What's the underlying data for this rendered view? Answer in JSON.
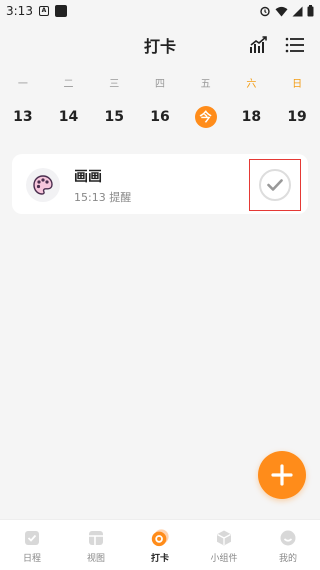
{
  "status_bar": {
    "time": "3:13",
    "notif_letter": "A"
  },
  "header": {
    "title": "打卡"
  },
  "week": {
    "days": [
      {
        "label": "一",
        "date": "13",
        "weekend": false,
        "today": false
      },
      {
        "label": "二",
        "date": "14",
        "weekend": false,
        "today": false
      },
      {
        "label": "三",
        "date": "15",
        "weekend": false,
        "today": false
      },
      {
        "label": "四",
        "date": "16",
        "weekend": false,
        "today": false
      },
      {
        "label": "五",
        "date": "今",
        "weekend": false,
        "today": true
      },
      {
        "label": "六",
        "date": "18",
        "weekend": true,
        "today": false
      },
      {
        "label": "日",
        "date": "19",
        "weekend": true,
        "today": false
      }
    ]
  },
  "task": {
    "title": "画画",
    "reminder": "15:13 提醒"
  },
  "tabs": [
    {
      "label": "日程",
      "icon": "schedule-icon",
      "active": false
    },
    {
      "label": "视图",
      "icon": "view-icon",
      "active": false
    },
    {
      "label": "打卡",
      "icon": "checkin-icon",
      "active": true
    },
    {
      "label": "小组件",
      "icon": "widget-icon",
      "active": false
    },
    {
      "label": "我的",
      "icon": "profile-icon",
      "active": false
    }
  ],
  "colors": {
    "accent": "#ff8c1a",
    "weekend": "#f39c12",
    "highlight_frame": "#e53935"
  }
}
